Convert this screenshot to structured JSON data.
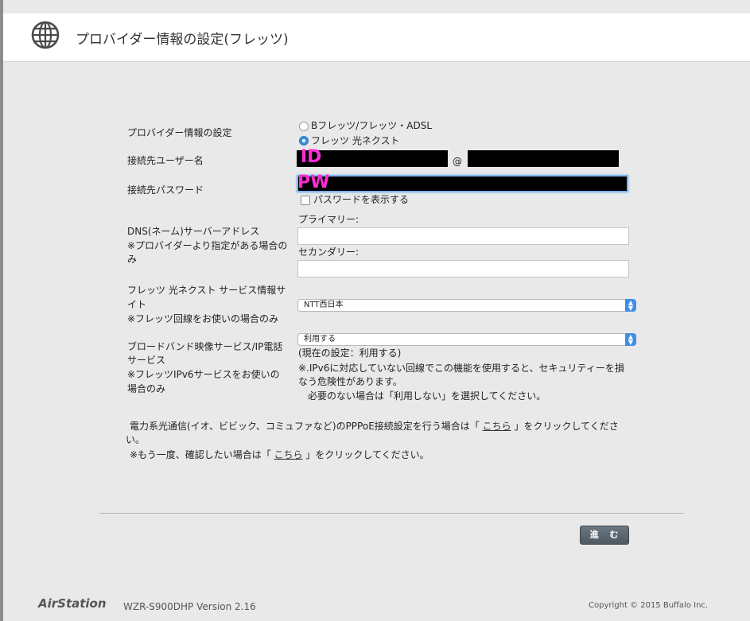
{
  "header": {
    "title": "プロバイダー情報の設定(フレッツ)"
  },
  "provider": {
    "label": "プロバイダー情報の設定",
    "options": [
      "Bフレッツ/フレッツ・ADSL",
      "フレッツ 光ネクスト"
    ],
    "selected_index": 1
  },
  "username": {
    "label": "接続先ユーザー名",
    "overlay": "ID",
    "at": "@"
  },
  "password": {
    "label": "接続先パスワード",
    "overlay": "PW",
    "show_label": "パスワードを表示する"
  },
  "dns": {
    "label_line1": "DNS(ネーム)サーバーアドレス",
    "label_line2": "※プロバイダーより指定がある場合の",
    "label_line3": "み",
    "primary_label": "プライマリー:",
    "primary_value": "",
    "secondary_label": "セカンダリー:",
    "secondary_value": ""
  },
  "flets_site": {
    "label_line1": "フレッツ 光ネクスト サービス情報サ",
    "label_line2": "イト",
    "label_line3": "※フレッツ回線をお使いの場合のみ",
    "selected": "NTT西日本"
  },
  "broadband": {
    "label_line1": "ブロードバンド映像サービス/IP電話",
    "label_line2": "サービス",
    "label_line3": "※フレッツIPv6サービスをお使いの",
    "label_line4": "場合のみ",
    "selected": "利用する",
    "current": "(現在の設定：利用する)",
    "note_line1": "※.IPv6に対応していない回線でこの機能を使用すると、セキュリティーを損",
    "note_line2": "なう危険性があります。",
    "note_line3": "必要のない場合は「利用しない」を選択してください。"
  },
  "notice": {
    "line1_before": "電力系光通信(イオ、ビビック、コミュファなど)のPPPoE接続設定を行う場合は「",
    "line1_link": "こちら",
    "line1_after": "」をクリックしてくださ",
    "line1_cont": "い。",
    "line2_before": "※もう一度、確認したい場合は「",
    "line2_link": "こちら",
    "line2_after": "」をクリックしてください。"
  },
  "next_button": "進 む",
  "footer": {
    "logo": "AirStation",
    "model": "WZR-S900DHP   Version 2.16",
    "copyright": "Copyright © 2015 Buffalo Inc."
  }
}
